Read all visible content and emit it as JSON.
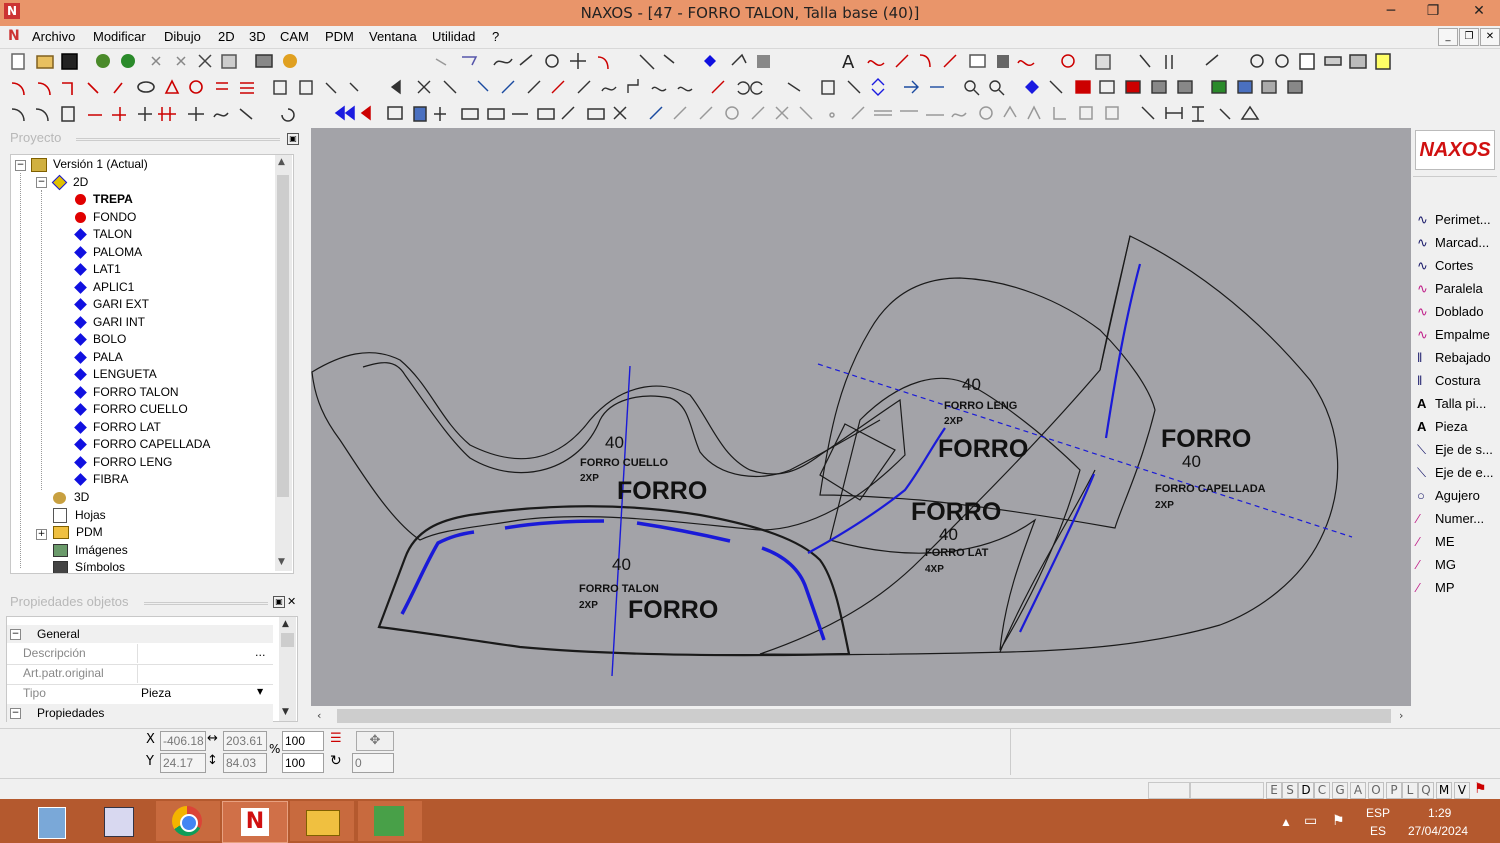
{
  "window": {
    "title": "NAXOS - [47 - FORRO TALON, Talla base (40)]",
    "minimize": "─",
    "restore": "❐",
    "close": "✕"
  },
  "menu": [
    "Archivo",
    "Modificar",
    "Dibujo",
    "2D",
    "3D",
    "CAM",
    "PDM",
    "Ventana",
    "Utilidad",
    "?"
  ],
  "project_panel": {
    "title": "Proyecto",
    "tree": [
      {
        "label": "Versión 1 (Actual)",
        "icon": "version-icon",
        "level": 0
      },
      {
        "label": "2D",
        "icon": "diamond-2d-icon",
        "level": 1
      },
      {
        "label": "TREPA",
        "icon": "red-dot",
        "level": 2,
        "bold": true
      },
      {
        "label": "FONDO",
        "icon": "red-dot",
        "level": 2
      },
      {
        "label": "TALON",
        "icon": "blue-diamond",
        "level": 2
      },
      {
        "label": "PALOMA",
        "icon": "blue-diamond",
        "level": 2
      },
      {
        "label": "LAT1",
        "icon": "blue-diamond",
        "level": 2
      },
      {
        "label": "APLIC1",
        "icon": "blue-diamond",
        "level": 2
      },
      {
        "label": "GARI EXT",
        "icon": "blue-diamond",
        "level": 2
      },
      {
        "label": "GARI INT",
        "icon": "blue-diamond",
        "level": 2
      },
      {
        "label": "BOLO",
        "icon": "blue-diamond",
        "level": 2
      },
      {
        "label": "PALA",
        "icon": "blue-diamond",
        "level": 2
      },
      {
        "label": "LENGUETA",
        "icon": "blue-diamond",
        "level": 2
      },
      {
        "label": "FORRO TALON",
        "icon": "blue-diamond",
        "level": 2
      },
      {
        "label": "FORRO CUELLO",
        "icon": "blue-diamond",
        "level": 2
      },
      {
        "label": "FORRO LAT",
        "icon": "blue-diamond",
        "level": 2
      },
      {
        "label": "FORRO CAPELLADA",
        "icon": "blue-diamond",
        "level": 2
      },
      {
        "label": "FORRO LENG",
        "icon": "blue-diamond",
        "level": 2
      },
      {
        "label": "FIBRA",
        "icon": "blue-diamond",
        "level": 2
      },
      {
        "label": "3D",
        "icon": "3d-icon",
        "level": 1
      },
      {
        "label": "Hojas",
        "icon": "sheets-icon",
        "level": 1
      },
      {
        "label": "PDM",
        "icon": "folder-icon",
        "level": 1
      },
      {
        "label": "Imágenes",
        "icon": "images-icon",
        "level": 1
      },
      {
        "label": "Símbolos",
        "icon": "symbols-icon",
        "level": 1
      }
    ]
  },
  "properties_panel": {
    "title": "Propiedades objetos",
    "general_label": "General",
    "rows": [
      {
        "label": "Descripción",
        "value": "",
        "button": "..."
      },
      {
        "label": "Art.patr.original",
        "value": ""
      },
      {
        "label": "Tipo",
        "value": "Pieza"
      }
    ],
    "propiedades_label": "Propiedades"
  },
  "canvas": {
    "labels": [
      {
        "text": "40"
      },
      {
        "text": "FORRO CUELLO"
      },
      {
        "text": "2XP"
      },
      {
        "text": "FORRO"
      },
      {
        "text": "40"
      },
      {
        "text": "FORRO TALON"
      },
      {
        "text": "2XP"
      },
      {
        "text": "FORRO"
      },
      {
        "text": "40"
      },
      {
        "text": "FORRO LENG"
      },
      {
        "text": "2XP"
      },
      {
        "text": "FORRO"
      },
      {
        "text": "FORRO"
      },
      {
        "text": "40"
      },
      {
        "text": "FORRO LAT"
      },
      {
        "text": "4XP"
      },
      {
        "text": "FORRO"
      },
      {
        "text": "40"
      },
      {
        "text": "FORRO CAPELLADA"
      },
      {
        "text": "2XP"
      }
    ]
  },
  "right_panel": {
    "logo": "NAXOS",
    "items": [
      "Perimet...",
      "Marcad...",
      "Cortes",
      "Paralela",
      "Doblado",
      "Empalme",
      "Rebajado",
      "Costura",
      "Talla pi...",
      "Pieza",
      "Eje de s...",
      "Eje de e...",
      "Agujero",
      "Numer...",
      "ME",
      "MG",
      "MP"
    ]
  },
  "coords": {
    "x_label": "X",
    "y_label": "Y",
    "x_value": "-406.18",
    "y_value": "24.17",
    "width_value": "203.61",
    "height_value": "84.03",
    "percent_label": "%",
    "scale_x": "100",
    "scale_y": "100",
    "rotation": "0"
  },
  "status_letters": [
    "E",
    "S",
    "D",
    "C",
    "G",
    "A",
    "O",
    "P",
    "L",
    "Q",
    "M",
    "V"
  ],
  "taskbar": {
    "lang_top": "ESP",
    "lang_bottom": "ES",
    "time": "1:29",
    "date": "27/04/2024"
  }
}
